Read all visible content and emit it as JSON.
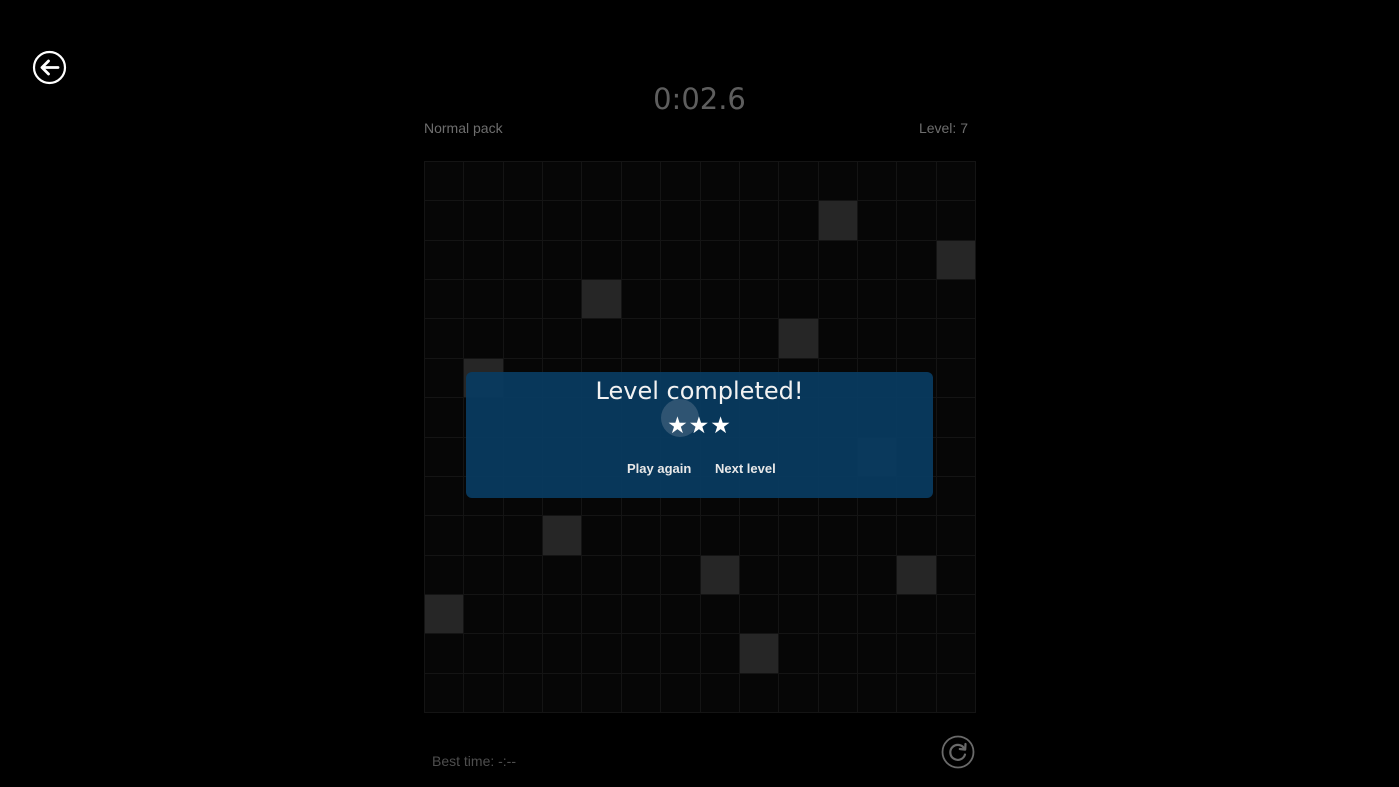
{
  "header": {
    "timer": "0:02.6",
    "pack": "Normal pack",
    "level": "Level: 7"
  },
  "board": {
    "columns": 14,
    "rows": 14,
    "filled_cells": [
      [
        1,
        10
      ],
      [
        2,
        13
      ],
      [
        3,
        4
      ],
      [
        4,
        9
      ],
      [
        5,
        1
      ],
      [
        7,
        11
      ],
      [
        9,
        3
      ],
      [
        10,
        7
      ],
      [
        10,
        12
      ],
      [
        11,
        0
      ],
      [
        12,
        8
      ]
    ]
  },
  "dialog": {
    "title": "Level completed!",
    "stars": "★★★",
    "play_again_label": "Play again",
    "next_level_label": "Next level"
  },
  "footer": {
    "best_time": "Best time: -:--"
  },
  "icons": {
    "back": "back-arrow-icon",
    "refresh": "refresh-icon"
  },
  "colors": {
    "background": "#000000",
    "dialog": "#083a60",
    "filled_cell": "#262626"
  }
}
